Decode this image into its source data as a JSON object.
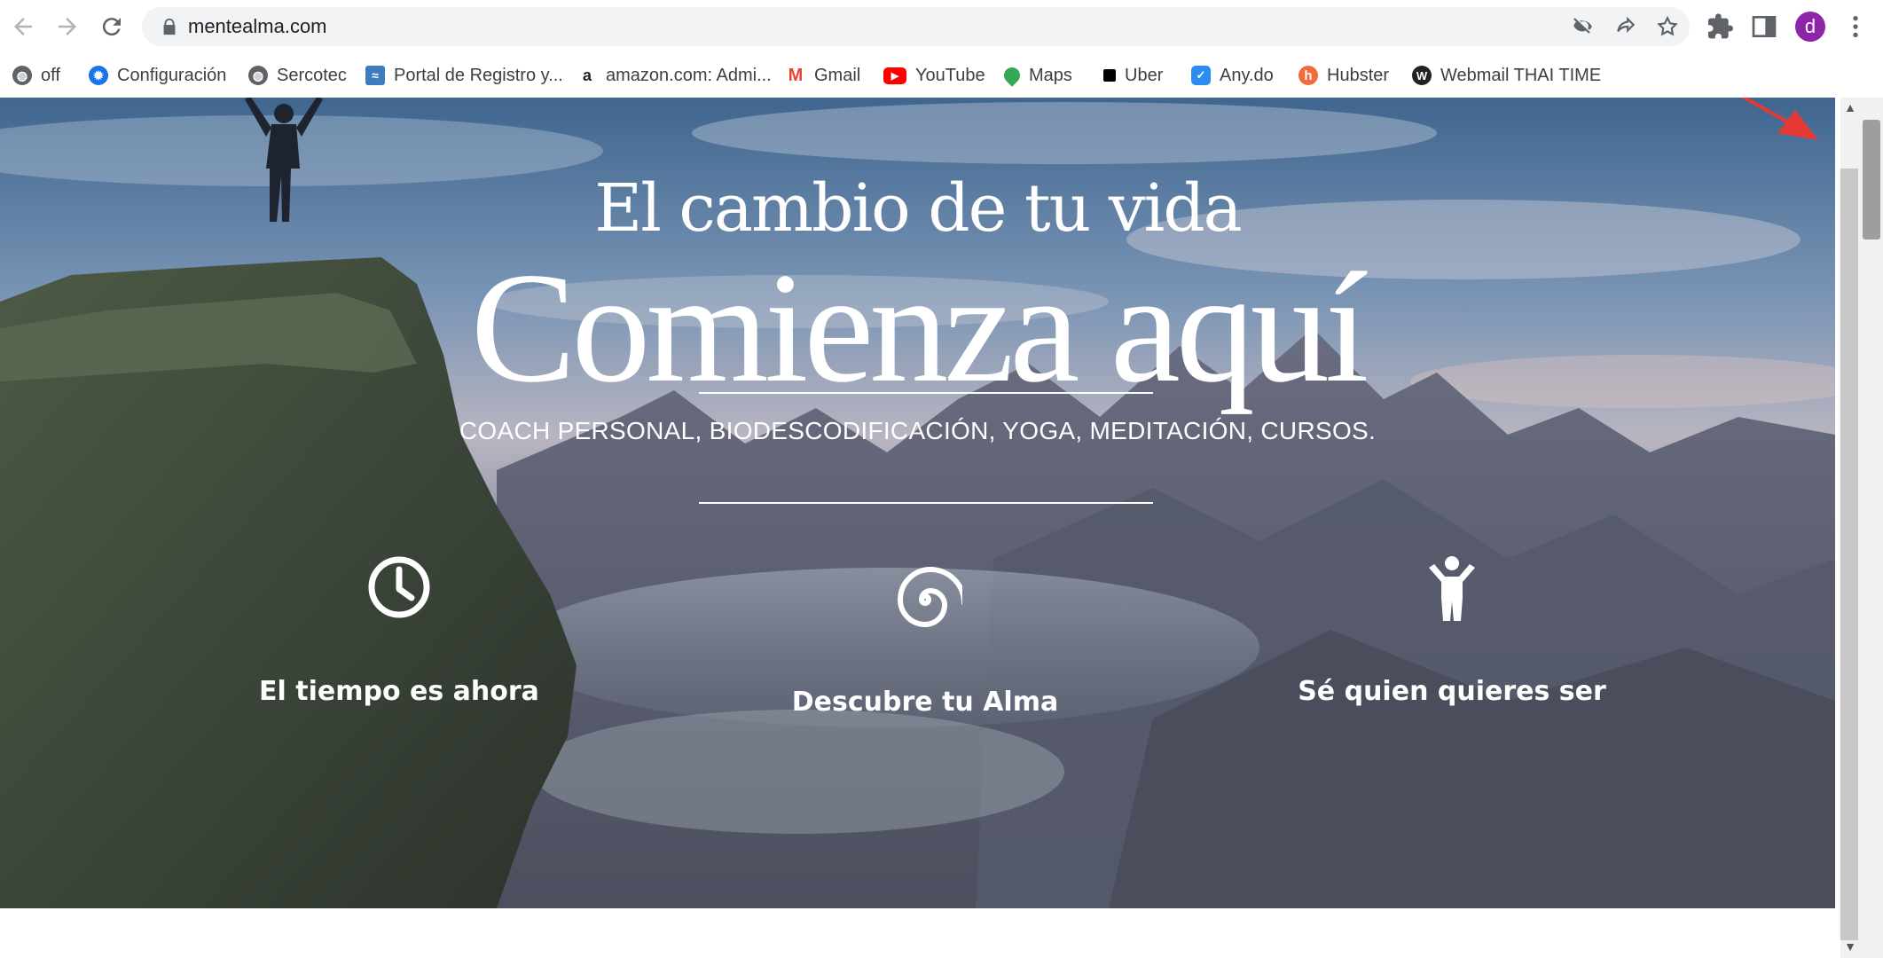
{
  "browser": {
    "url": "mentealma.com",
    "avatar_letter": "d",
    "bookmarks": [
      {
        "label": "off",
        "icon": "globe-icon"
      },
      {
        "label": "Configuración",
        "icon": "gear-icon"
      },
      {
        "label": "Sercotec",
        "icon": "globe-icon"
      },
      {
        "label": "Portal de Registro y...",
        "icon": "portal-icon"
      },
      {
        "label": "amazon.com: Admi...",
        "icon": "amazon-icon"
      },
      {
        "label": "Gmail",
        "icon": "gmail-icon"
      },
      {
        "label": "YouTube",
        "icon": "youtube-icon"
      },
      {
        "label": "Maps",
        "icon": "maps-icon"
      },
      {
        "label": "Uber",
        "icon": "uber-icon"
      },
      {
        "label": "Any.do",
        "icon": "anydo-icon"
      },
      {
        "label": "Hubster",
        "icon": "hubster-icon"
      },
      {
        "label": "Webmail THAI TIME",
        "icon": "webmail-icon"
      }
    ]
  },
  "hero": {
    "title_small": "El cambio de tu vida",
    "title_big": "Comienza aquí",
    "subtitle": "COACH PERSONAL, BIODESCODIFICACIÓN, YOGA, MEDITACIÓN, CURSOS.",
    "features": [
      {
        "label": "El tiempo es ahora",
        "icon": "clock-icon"
      },
      {
        "label": "Descubre tu Alma",
        "icon": "spiral-icon"
      },
      {
        "label": "Sé quien quieres ser",
        "icon": "person-icon"
      }
    ]
  },
  "colors": {
    "accent": "#8e24aa",
    "annotation_arrow": "#e53935"
  }
}
